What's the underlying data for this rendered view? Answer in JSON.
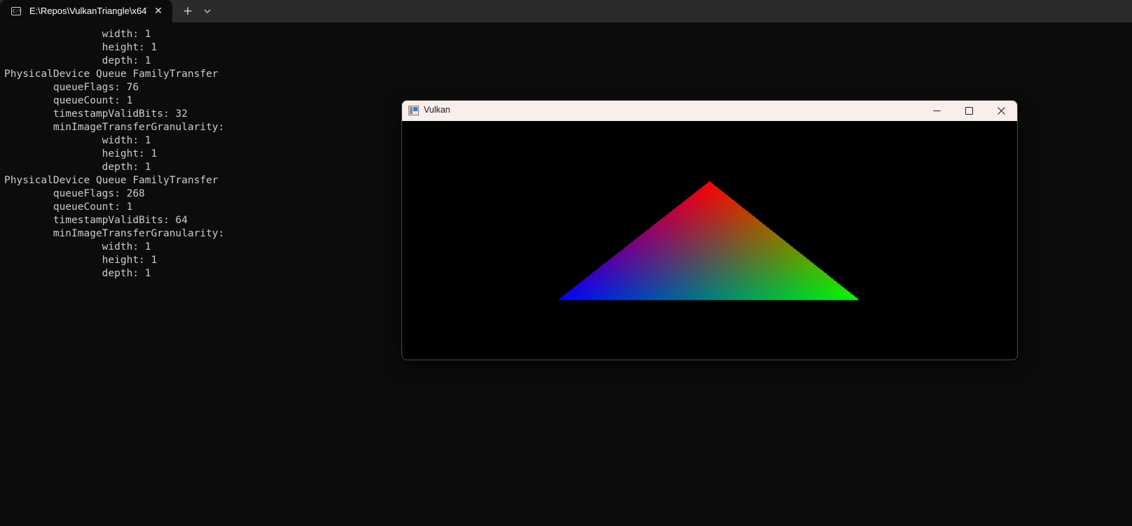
{
  "terminal": {
    "tab": {
      "icon": "command-prompt-icon",
      "icon_text": "C:\\",
      "title": "E:\\Repos\\VulkanTriangle\\x64\\"
    },
    "new_tab_label": "+",
    "close_label": "✕",
    "console_lines": [
      "                width: 1",
      "                height: 1",
      "                depth: 1",
      "PhysicalDevice Queue FamilyTransfer",
      "        queueFlags: 76",
      "        queueCount: 1",
      "        timestampValidBits: 32",
      "        minImageTransferGranularity:",
      "                width: 1",
      "                height: 1",
      "                depth: 1",
      "PhysicalDevice Queue FamilyTransfer",
      "        queueFlags: 268",
      "        queueCount: 1",
      "        timestampValidBits: 64",
      "        minImageTransferGranularity:",
      "                width: 1",
      "                height: 1",
      "                depth: 1"
    ]
  },
  "vulkan_window": {
    "title": "Vulkan",
    "buttons": {
      "minimize": "minimize-icon",
      "maximize": "maximize-icon",
      "close": "close-icon"
    },
    "triangle": {
      "top_color": "#ff0000",
      "left_color": "#0000ff",
      "right_color": "#00ff00"
    }
  },
  "colors": {
    "terminal_bg": "#0c0c0c",
    "tabbar_bg": "#2b2b2b",
    "console_text": "#cccccc",
    "vulkan_titlebar": "#f8eeec"
  }
}
